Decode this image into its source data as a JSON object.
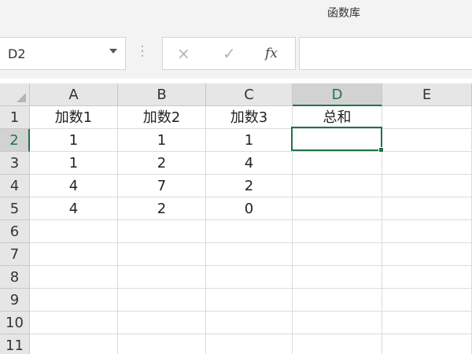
{
  "ribbon": {
    "label": "函数库"
  },
  "formula_bar": {
    "name_box": "D2",
    "cancel_icon": "×",
    "enter_icon": "✓",
    "fx_label": "fx",
    "formula_value": ""
  },
  "grid": {
    "columns": [
      "A",
      "B",
      "C",
      "D",
      "E"
    ],
    "rows": [
      "1",
      "2",
      "3",
      "4",
      "5",
      "6",
      "7",
      "8",
      "9",
      "10",
      "11"
    ],
    "cells": [
      [
        "加数1",
        "加数2",
        "加数3",
        "总和",
        ""
      ],
      [
        "1",
        "1",
        "1",
        "",
        ""
      ],
      [
        "1",
        "2",
        "4",
        "",
        ""
      ],
      [
        "4",
        "7",
        "2",
        "",
        ""
      ],
      [
        "4",
        "2",
        "0",
        "",
        ""
      ],
      [
        "",
        "",
        "",
        "",
        ""
      ],
      [
        "",
        "",
        "",
        "",
        ""
      ],
      [
        "",
        "",
        "",
        "",
        ""
      ],
      [
        "",
        "",
        "",
        "",
        ""
      ],
      [
        "",
        "",
        "",
        "",
        ""
      ],
      [
        "",
        "",
        "",
        "",
        ""
      ]
    ],
    "selected_column": "D",
    "selected_row": "2"
  },
  "colors": {
    "accent": "#217346",
    "header_bg": "#e6e6e6",
    "grid_line": "#dcdcdc"
  }
}
